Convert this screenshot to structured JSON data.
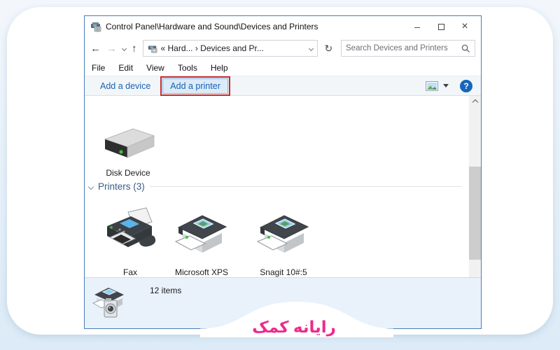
{
  "window": {
    "title": "Control Panel\\Hardware and Sound\\Devices and Printers",
    "controls": {
      "minimize": "–",
      "close": "×"
    }
  },
  "navbar": {
    "back": "←",
    "forward": "→",
    "up": "↑",
    "refresh": "↻",
    "address_text": "« Hard...  ›  Devices and Pr...",
    "search_placeholder": "Search Devices and Printers"
  },
  "menubar": {
    "items": [
      "File",
      "Edit",
      "View",
      "Tools",
      "Help"
    ]
  },
  "toolbar": {
    "add_device_label": "Add a device",
    "add_printer_label": "Add a printer",
    "help_label": "?"
  },
  "content": {
    "devices": [
      {
        "label": "Disk Device"
      }
    ],
    "printers_header": "Printers (3)",
    "printers": [
      {
        "label": "Fax"
      },
      {
        "label": "Microsoft XPS"
      },
      {
        "label": "Snagit 10#:5"
      }
    ]
  },
  "statusbar": {
    "items_count": "12 items"
  },
  "watermark": {
    "text": "رایانه کمک"
  },
  "colors": {
    "window_border": "#4b7db5",
    "toolbar_link_blue": "#1a62b0",
    "printer_highlight_bg": "#dcebf8",
    "annotation_red": "#ce2a28",
    "group_header_blue": "#3d5a87",
    "statusbar_bg": "#e9f1fb",
    "watermark_pink": "#ee2a8b",
    "help_blue": "#1467bd",
    "led_green": "#3fbf3f"
  }
}
